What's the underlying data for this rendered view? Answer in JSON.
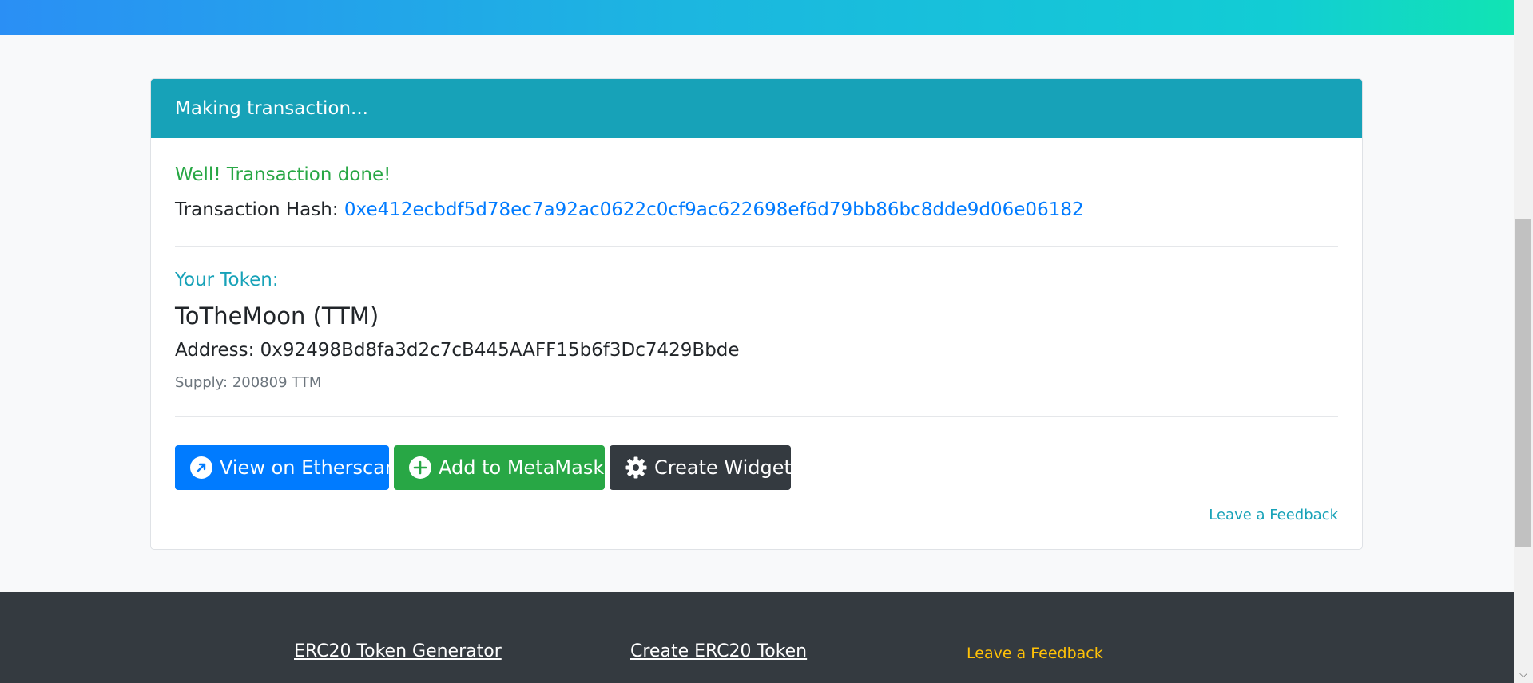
{
  "card": {
    "header": "Making transaction...",
    "success_message": "Well! Transaction done!",
    "hash_label": "Transaction Hash: ",
    "hash_value": "0xe412ecbdf5d78ec7a92ac0622c0cf9ac622698ef6d79bb86bc8dde9d06e06182",
    "your_token_label": "Your Token:",
    "token_name": "ToTheMoon (TTM)",
    "address_label": "Address: ",
    "address_value": "0x92498Bd8fa3d2c7cB445AAFF15b6f3Dc7429Bbde",
    "supply_text": "Supply: 200809 TTM",
    "buttons": {
      "etherscan": "View on Etherscan",
      "metamask": "Add to MetaMask",
      "widget": "Create Widget"
    },
    "feedback_link": "Leave a Feedback"
  },
  "footer": {
    "items": [
      "ERC20 Token Generator",
      "Create ERC20 Token",
      "Leave a Feedback"
    ]
  },
  "icons": {
    "etherscan": "external-link-circle-icon",
    "metamask": "plus-circle-icon",
    "widget": "gear-icon"
  },
  "colors": {
    "primary": "#007bff",
    "success": "#28a745",
    "dark": "#343a40",
    "info": "#17a2b8",
    "warning": "#ffc107"
  }
}
